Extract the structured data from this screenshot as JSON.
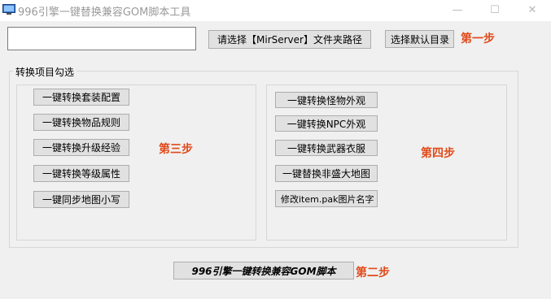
{
  "window": {
    "title": "996引擎一键替换兼容GOM脚本工具",
    "controls": {
      "minimize": "—",
      "maximize": "☐",
      "close": "✕"
    }
  },
  "path_row": {
    "input_value": "",
    "input_placeholder": "",
    "select_folder_button": "请选择【MirServer】文件夹路径",
    "default_dir_button": "选择默认目录",
    "step_label": "第一步"
  },
  "group": {
    "title": "转换项目勾选",
    "left_buttons": [
      "一键转换套装配置",
      "一键转换物品规则",
      "一键转换升级经验",
      "一键转换等级属性",
      "一键同步地图小写"
    ],
    "left_step": "第三步",
    "right_buttons": [
      "一键转换怪物外观",
      "一键转换NPC外观",
      "一键转换武器衣服",
      "一键替换非盛大地图",
      "修改item.pak图片名字"
    ],
    "right_step": "第四步"
  },
  "main_action": {
    "button": "996引擎一键转换兼容GOM脚本",
    "step_label": "第二步"
  },
  "colors": {
    "step_accent": "#e04a1a",
    "button_bg": "#e1e1e1",
    "window_bg": "#f0f0f0"
  }
}
